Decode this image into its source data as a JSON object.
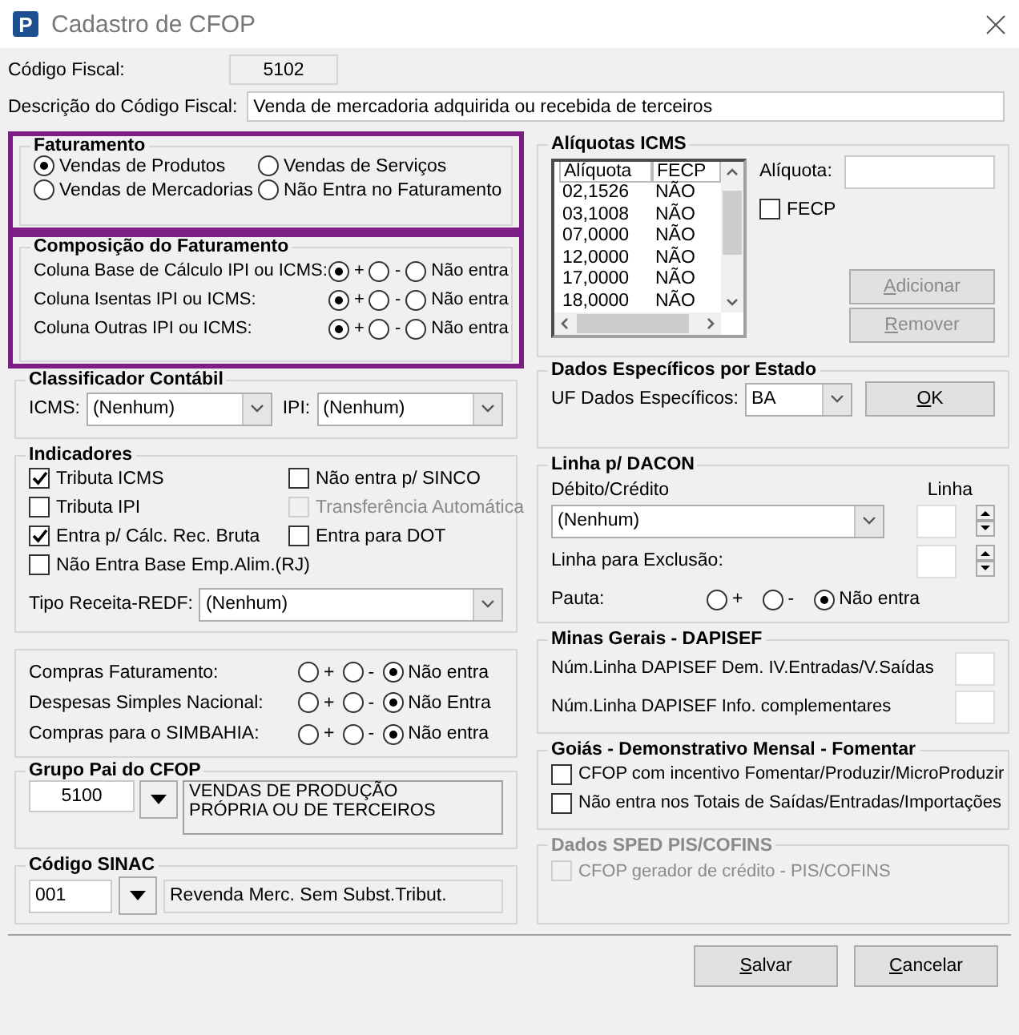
{
  "window": {
    "title": "Cadastro de CFOP",
    "logo_text": "P"
  },
  "codigo_fiscal": {
    "label": "Código Fiscal:",
    "value": "5102"
  },
  "descricao": {
    "label": "Descrição do Código Fiscal:",
    "value": "Venda de mercadoria adquirida ou recebida de terceiros"
  },
  "faturamento": {
    "title": "Faturamento",
    "highlighted": true,
    "options": [
      {
        "label": "Vendas de Produtos",
        "selected": true
      },
      {
        "label": "Vendas de Serviços",
        "selected": false
      },
      {
        "label": "Vendas de Mercadorias",
        "selected": false
      },
      {
        "label": "Não Entra no Faturamento",
        "selected": false
      }
    ]
  },
  "composicao": {
    "title": "Composição do Faturamento",
    "highlighted": true,
    "rows": [
      {
        "label": "Coluna Base de Cálculo IPI ou ICMS:",
        "options": [
          {
            "label": "+",
            "selected": true
          },
          {
            "label": "-",
            "selected": false
          },
          {
            "label": "Não entra",
            "selected": false
          }
        ]
      },
      {
        "label": "Coluna Isentas IPI ou ICMS:",
        "options": [
          {
            "label": "+",
            "selected": true
          },
          {
            "label": "-",
            "selected": false
          },
          {
            "label": "Não entra",
            "selected": false
          }
        ]
      },
      {
        "label": "Coluna Outras IPI ou ICMS:",
        "options": [
          {
            "label": "+",
            "selected": true
          },
          {
            "label": "-",
            "selected": false
          },
          {
            "label": "Não entra",
            "selected": false
          }
        ]
      }
    ]
  },
  "aliquotas_icms": {
    "title": "Alíquotas ICMS",
    "columns": [
      "Alíquota",
      "FECP"
    ],
    "rows": [
      [
        "02,1526",
        "NÃO"
      ],
      [
        "03,1008",
        "NÃO"
      ],
      [
        "07,0000",
        "NÃO"
      ],
      [
        "12,0000",
        "NÃO"
      ],
      [
        "17,0000",
        "NÃO"
      ],
      [
        "18,0000",
        "NÃO"
      ]
    ],
    "aliquota_label": "Alíquota:",
    "fecp": {
      "label": "FECP",
      "checked": false
    },
    "buttons": [
      {
        "label": "Adicionar",
        "disabled": true
      },
      {
        "label": "Remover",
        "disabled": true
      }
    ]
  },
  "classificador": {
    "title": "Classificador Contábil",
    "fields": [
      {
        "label": "ICMS:",
        "value": "(Nenhum)"
      },
      {
        "label": "IPI:",
        "value": "(Nenhum)"
      }
    ]
  },
  "dados_estado": {
    "title": "Dados Específicos por Estado",
    "label": "UF Dados Específicos:",
    "value": "BA",
    "button": {
      "label": "OK",
      "disabled": false
    }
  },
  "indicadores": {
    "title": "Indicadores",
    "checkboxes": [
      {
        "label": "Tributa ICMS",
        "checked": true,
        "disabled": false
      },
      {
        "label": "Não entra p/ SINCO",
        "checked": false,
        "disabled": false
      },
      {
        "label": "Tributa IPI",
        "checked": false,
        "disabled": false
      },
      {
        "label": "Transferência Automática",
        "checked": false,
        "disabled": true
      },
      {
        "label": "Entra p/ Cálc. Rec. Bruta",
        "checked": true,
        "disabled": false
      },
      {
        "label": "Entra para DOT",
        "checked": false,
        "disabled": false
      },
      {
        "label": "Não Entra Base Emp.Alim.(RJ)",
        "checked": false,
        "disabled": false
      }
    ],
    "tipo_receita": {
      "label": "Tipo Receita-REDF:",
      "value": "(Nenhum)"
    }
  },
  "dacon": {
    "title": "Linha p/ DACON",
    "debito_label": "Débito/Crédito",
    "debito_value": "(Nenhum)",
    "linha_label": "Linha",
    "exclusao_label": "Linha para Exclusão:",
    "pauta": {
      "label": "Pauta:",
      "options": [
        {
          "label": "+",
          "selected": false
        },
        {
          "label": "-",
          "selected": false
        },
        {
          "label": "Não entra",
          "selected": true
        }
      ]
    }
  },
  "compras": {
    "rows": [
      {
        "label": "Compras Faturamento:",
        "options": [
          {
            "label": "+",
            "selected": false
          },
          {
            "label": "-",
            "selected": false
          },
          {
            "label": "Não entra",
            "selected": true
          }
        ]
      },
      {
        "label": "Despesas Simples Nacional:",
        "options": [
          {
            "label": "+",
            "selected": false
          },
          {
            "label": "-",
            "selected": false
          },
          {
            "label": "Não Entra",
            "selected": true
          }
        ]
      },
      {
        "label": "Compras para o SIMBAHIA:",
        "options": [
          {
            "label": "+",
            "selected": false
          },
          {
            "label": "-",
            "selected": false
          },
          {
            "label": "Não entra",
            "selected": true
          }
        ]
      }
    ]
  },
  "minas_gerais": {
    "title": "Minas Gerais - DAPISEF",
    "fields": [
      {
        "label": "Núm.Linha DAPISEF Dem. IV.Entradas/V.Saídas"
      },
      {
        "label": "Núm.Linha DAPISEF Info. complementares"
      }
    ]
  },
  "grupo_pai": {
    "title": "Grupo Pai do CFOP",
    "code": "5100",
    "description": "VENDAS DE PRODUÇÃO PRÓPRIA OU DE TERCEIROS"
  },
  "goias": {
    "title": "Goiás - Demonstrativo Mensal - Fomentar",
    "checkboxes": [
      {
        "label": "CFOP com incentivo  Fomentar/Produzir/MicroProduzir",
        "checked": false
      },
      {
        "label": "Não entra nos Totais de  Saídas/Entradas/Importações",
        "checked": false
      }
    ]
  },
  "codigo_sinac": {
    "title": "Código SINAC",
    "code": "001",
    "description": "Revenda Merc. Sem Subst.Tribut."
  },
  "sped": {
    "title": "Dados SPED PIS/COFINS",
    "disabled": true,
    "checkbox": {
      "label": "CFOP gerador de crédito - PIS/COFINS",
      "checked": false,
      "disabled": true
    }
  },
  "buttons": [
    {
      "label": "Salvar",
      "disabled": false
    },
    {
      "label": "Cancelar",
      "disabled": false
    }
  ]
}
